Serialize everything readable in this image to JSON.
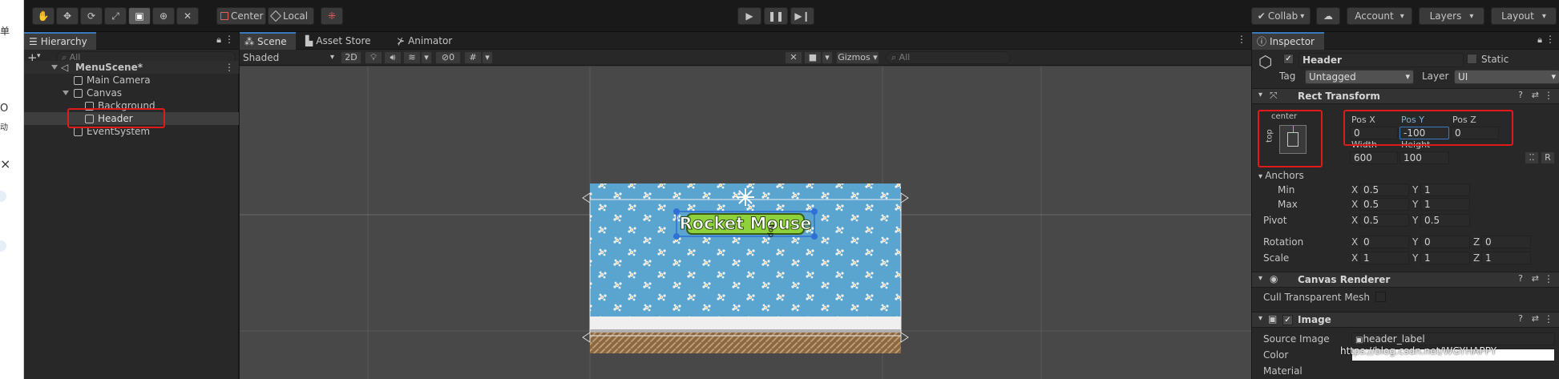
{
  "left_strip": {
    "glyphs": [
      "单",
      "O",
      "动",
      "×"
    ]
  },
  "toolbar": {
    "pivot_label": "Center",
    "space_label": "Local",
    "collab_label": "Collab",
    "account_label": "Account",
    "layers_label": "Layers",
    "layout_label": "Layout"
  },
  "hierarchy": {
    "tab_label": "Hierarchy",
    "search_placeholder": "All",
    "items": [
      {
        "label": "MenuScene*"
      },
      {
        "label": "Main Camera"
      },
      {
        "label": "Canvas"
      },
      {
        "label": "Background"
      },
      {
        "label": "Header"
      },
      {
        "label": "EventSystem"
      }
    ]
  },
  "scene": {
    "tabs": [
      {
        "label": "Scene"
      },
      {
        "label": "Asset Store"
      },
      {
        "label": "Animator"
      }
    ],
    "shading_mode": "Shaded",
    "mode_2d": "2D",
    "hidden_count": "0",
    "gizmos_label": "Gizmos",
    "search_placeholder": "All",
    "header_text": "Rocket Mouse",
    "pivot_text": "top"
  },
  "inspector": {
    "tab_label": "Inspector",
    "object_name": "Header",
    "static_label": "Static",
    "tag_label": "Tag",
    "tag_value": "Untagged",
    "layer_label": "Layer",
    "layer_value": "UI",
    "rect_transform": {
      "title": "Rect Transform",
      "anchor_preset_top": "center",
      "anchor_preset_side": "top",
      "pos_x_label": "Pos X",
      "pos_x": "0",
      "pos_y_label": "Pos Y",
      "pos_y": "-100",
      "pos_z_label": "Pos Z",
      "pos_z": "0",
      "width_label": "Width",
      "width": "600",
      "height_label": "Height",
      "height": "100",
      "r_button": "R",
      "anchors_label": "Anchors",
      "min_label": "Min",
      "min_x": "0.5",
      "min_y": "1",
      "max_label": "Max",
      "max_x": "0.5",
      "max_y": "1",
      "pivot_label": "Pivot",
      "pivot_x": "0.5",
      "pivot_y": "0.5",
      "rotation_label": "Rotation",
      "rot_x": "0",
      "rot_y": "0",
      "rot_z": "0",
      "scale_label": "Scale",
      "scale_x": "1",
      "scale_y": "1",
      "scale_z": "1",
      "x_letter": "X",
      "y_letter": "Y",
      "z_letter": "Z"
    },
    "canvas_renderer": {
      "title": "Canvas Renderer",
      "cull_label": "Cull Transparent Mesh"
    },
    "image": {
      "title": "Image",
      "source_label": "Source Image",
      "source_value": "header_label",
      "color_label": "Color",
      "material_label": "Material",
      "watermark": "https://blog.csdn.net/WGYHAPPY"
    }
  },
  "colors": {
    "selection_red": "#e01919",
    "accent_blue": "#3a79bb",
    "sky_blue": "#5aa4d0",
    "title_green": "#8fd13a"
  }
}
